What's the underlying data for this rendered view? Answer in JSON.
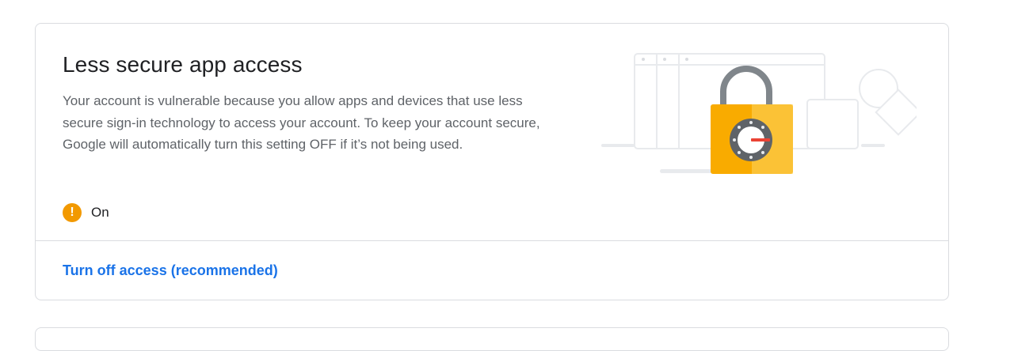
{
  "card": {
    "title": "Less secure app access",
    "description": "Your account is vulnerable because you allow apps and devices that use less secure sign-in technology to access your account. To keep your account secure, Google will automatically turn this setting OFF if it’s not being used.",
    "status": {
      "icon": "warning-icon",
      "icon_glyph": "!",
      "icon_color": "#f29900",
      "label": "On"
    },
    "action": {
      "label": "Turn off access (recommended)",
      "color": "#1a73e8"
    },
    "illustration": {
      "icon": "unlocked-padlock-icon",
      "lock_color": "#f9ab00",
      "dial_color": "#5f6368",
      "needle_color": "#ea4335"
    }
  }
}
